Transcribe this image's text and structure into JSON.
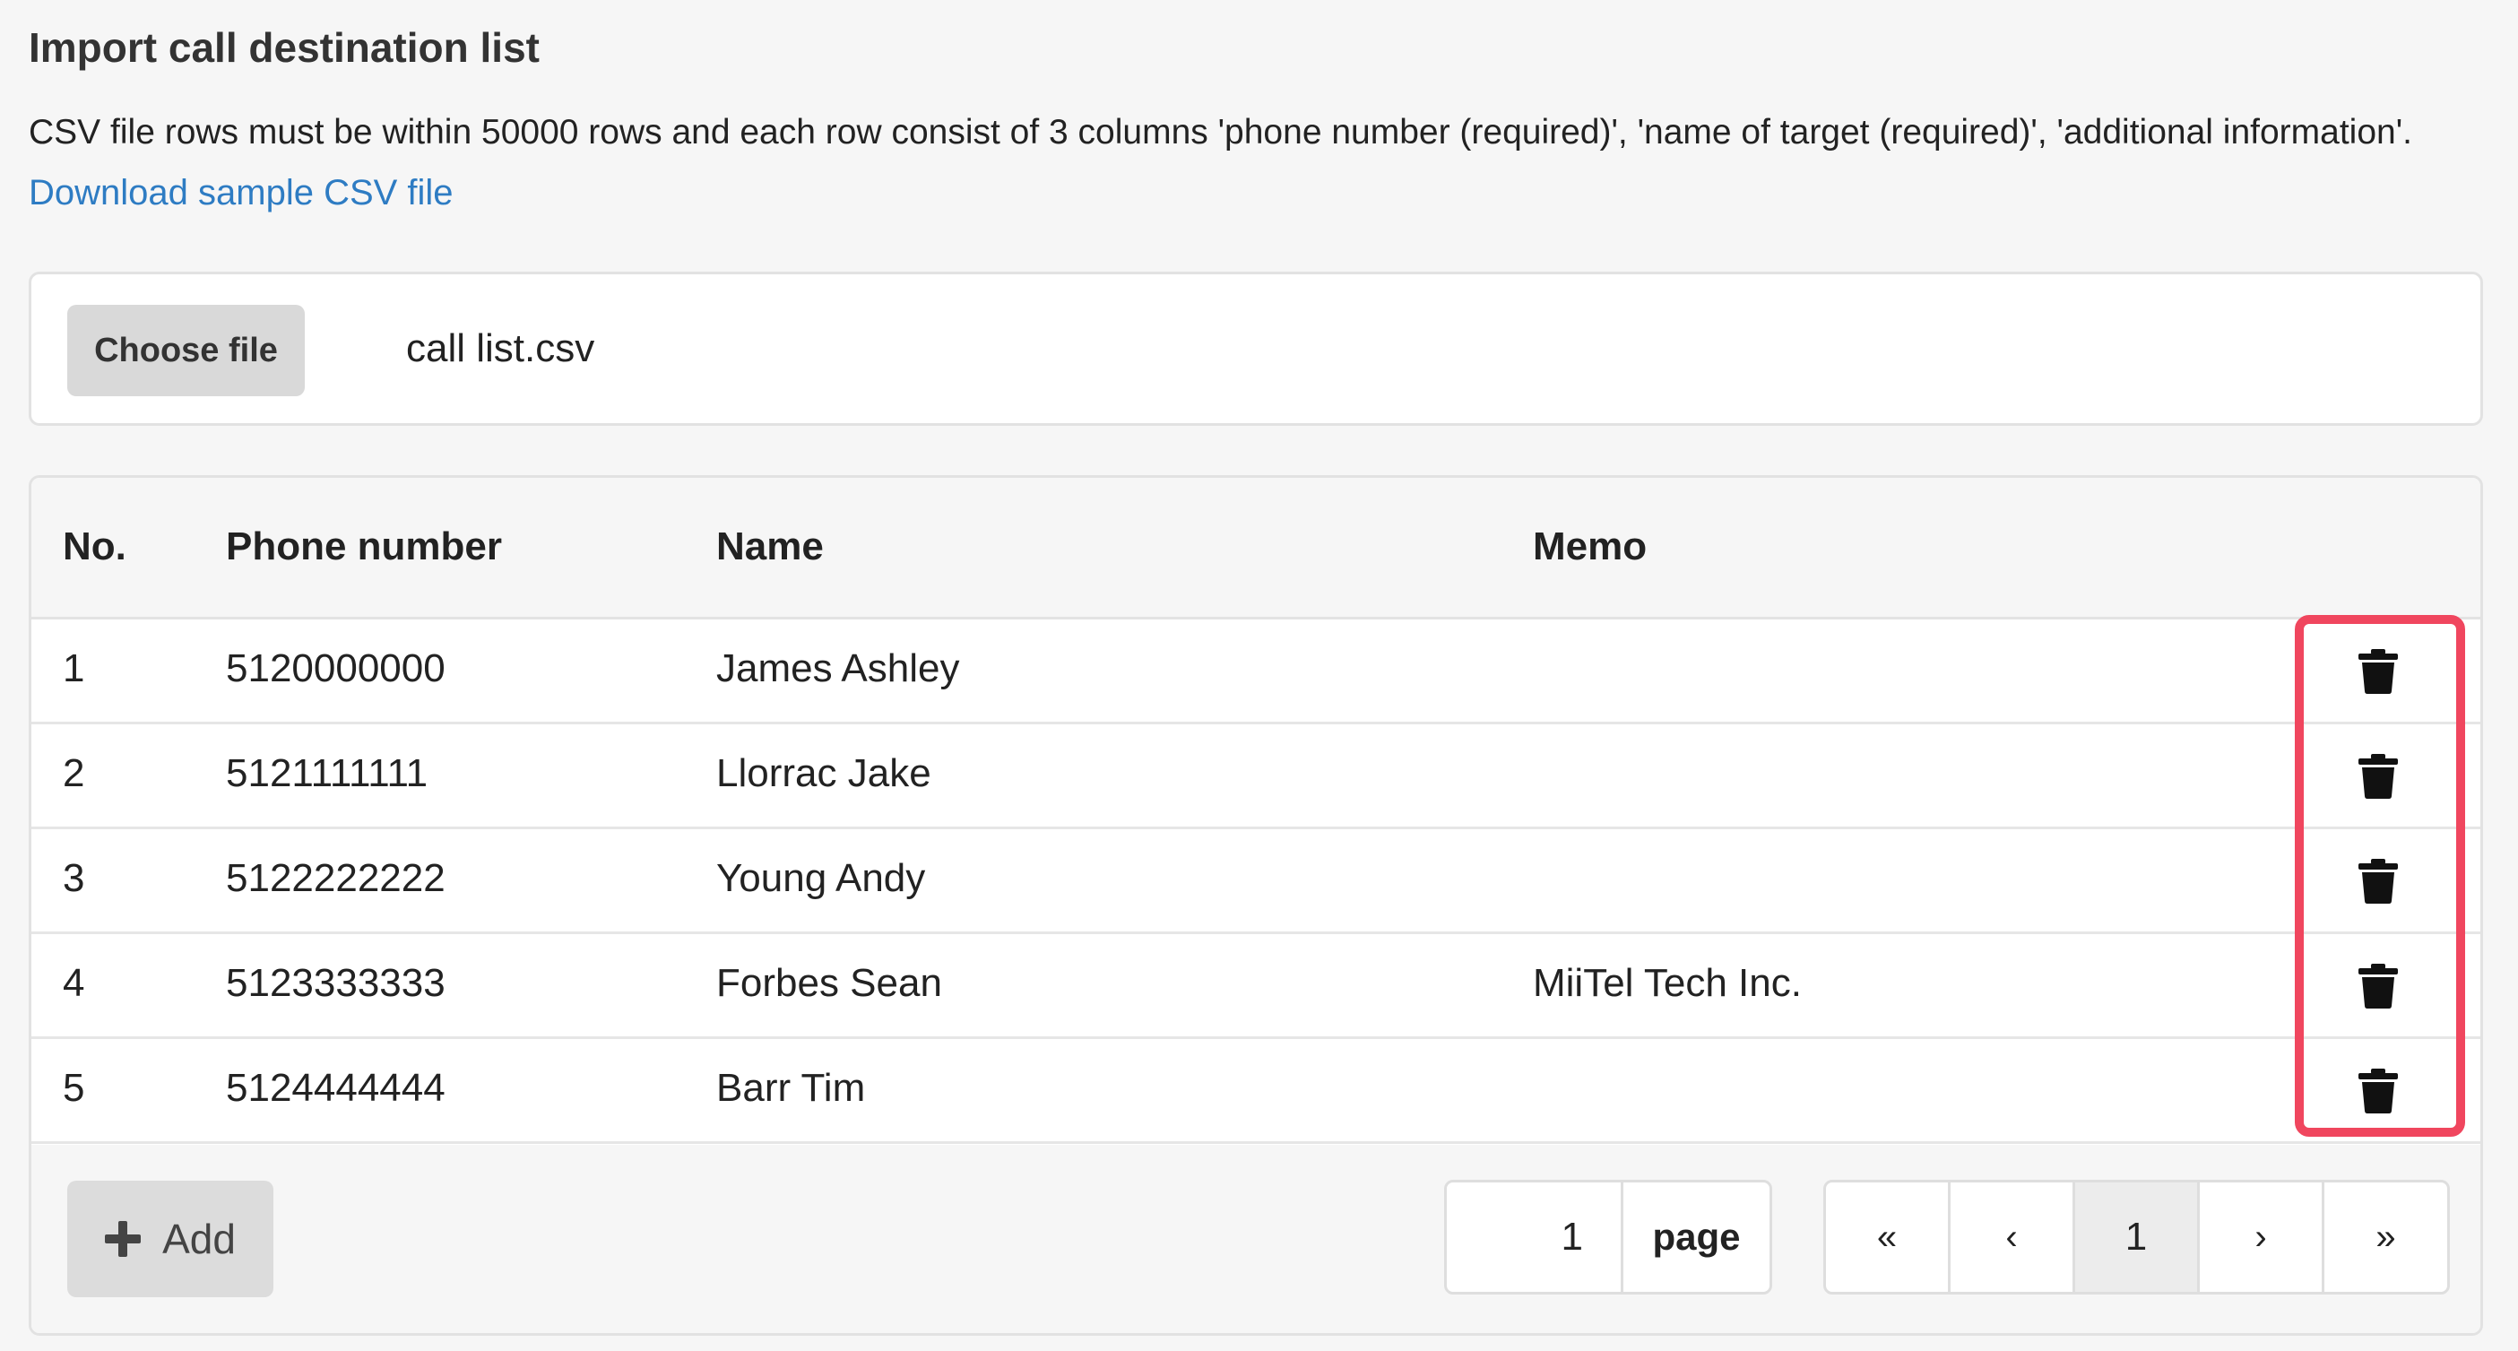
{
  "header": {
    "title": "Import call destination list",
    "description": "CSV file rows must be within 50000 rows and each row consist of 3 columns 'phone number (required)', 'name of target (required)', 'additional information'.",
    "sample_link": "Download sample CSV file"
  },
  "file_picker": {
    "button_label": "Choose file",
    "file_name": "call list.csv"
  },
  "table": {
    "columns": [
      "No.",
      "Phone number",
      "Name",
      "Memo"
    ],
    "rows": [
      {
        "no": "1",
        "phone": "5120000000",
        "name": "James Ashley",
        "memo": ""
      },
      {
        "no": "2",
        "phone": "5121111111",
        "name": "Llorrac Jake",
        "memo": ""
      },
      {
        "no": "3",
        "phone": "5122222222",
        "name": "Young Andy",
        "memo": ""
      },
      {
        "no": "4",
        "phone": "5123333333",
        "name": "Forbes Sean",
        "memo": "MiiTel Tech Inc."
      },
      {
        "no": "5",
        "phone": "5124444444",
        "name": "Barr Tim",
        "memo": ""
      }
    ],
    "row_action_icon": "trash-icon"
  },
  "footer": {
    "add_label": "Add",
    "page_input_value": "1",
    "page_label": "page",
    "pager": {
      "first": "«",
      "prev": "‹",
      "current": "1",
      "next": "›",
      "last": "»"
    }
  },
  "colors": {
    "link": "#2e7cc3",
    "highlight": "#f0465e",
    "background": "#f6f6f6"
  }
}
